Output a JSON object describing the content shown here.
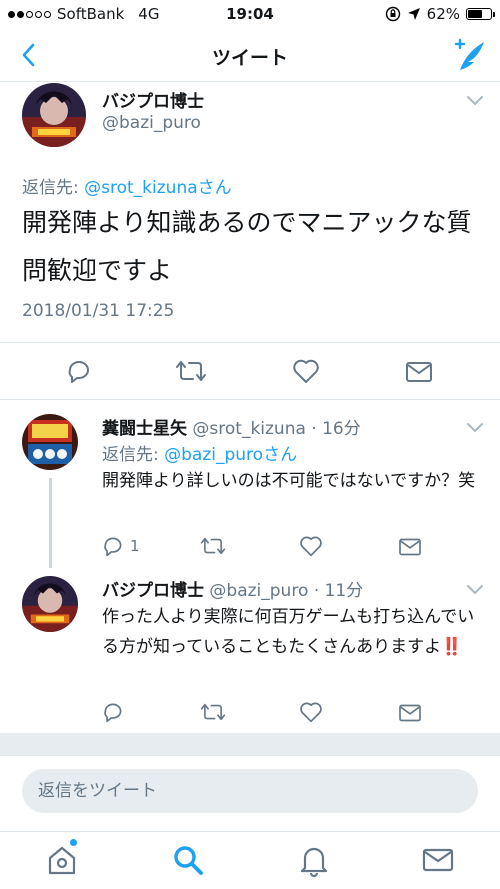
{
  "status_bar": {
    "carrier": "SoftBank",
    "network": "4G",
    "time": "19:04",
    "battery": "62%",
    "battery_level": 0.62
  },
  "nav": {
    "title": "ツイート",
    "back_icon": "chevron-left-icon",
    "compose_icon": "compose-tweet-icon"
  },
  "main_tweet": {
    "name": "バジプロ博士",
    "handle": "@bazi_puro",
    "reply_prefix": "返信先: ",
    "reply_mention": "@srot_kizunaさん",
    "text": "開発陣より知識あるのでマニアックな質問歓迎ですよ",
    "timestamp": "2018/01/31 17:25"
  },
  "replies": [
    {
      "name": "糞闘士星矢",
      "handle": "@srot_kizuna",
      "age": "· 16分",
      "reply_prefix": "返信先: ",
      "reply_mention": "@bazi_puroさん",
      "text": "開発陣より詳しいのは不可能ではないですか？笑",
      "reply_count": "1"
    },
    {
      "name": "バジプロ博士",
      "handle": "@bazi_puro",
      "age": "· 11分",
      "text": "作った人より実際に何百万ゲームも打ち込んでいる方が知っていることもたくさんありますよ",
      "emoji": "‼️"
    }
  ],
  "composer": {
    "placeholder": "返信をツイート"
  },
  "tabs": [
    "home-icon",
    "search-icon",
    "notifications-icon",
    "messages-icon"
  ],
  "colors": {
    "accent": "#1da1f2",
    "secondary_text": "#657786",
    "divider": "#e1e8ed"
  }
}
